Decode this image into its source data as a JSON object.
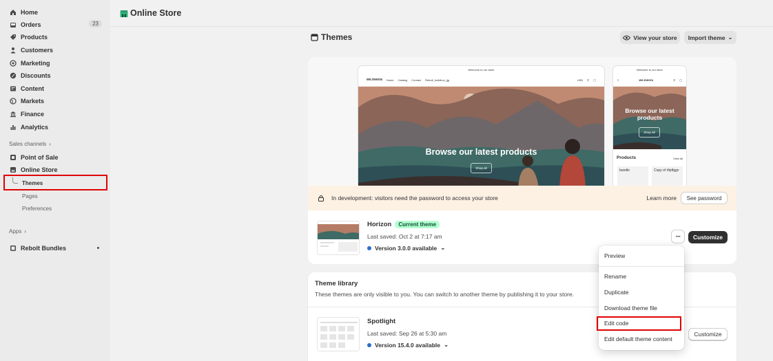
{
  "sidebar": {
    "items": [
      {
        "label": "Home",
        "icon": "home-icon"
      },
      {
        "label": "Orders",
        "icon": "inbox-icon",
        "badge": "23"
      },
      {
        "label": "Products",
        "icon": "tag-icon"
      },
      {
        "label": "Customers",
        "icon": "person-icon"
      },
      {
        "label": "Marketing",
        "icon": "target-icon"
      },
      {
        "label": "Discounts",
        "icon": "discount-icon"
      },
      {
        "label": "Content",
        "icon": "content-icon"
      },
      {
        "label": "Markets",
        "icon": "globe-icon"
      },
      {
        "label": "Finance",
        "icon": "bank-icon"
      },
      {
        "label": "Analytics",
        "icon": "chart-icon"
      }
    ],
    "sales_channels_label": "Sales channels",
    "channels": [
      {
        "label": "Point of Sale",
        "icon": "pos-icon"
      },
      {
        "label": "Online Store",
        "icon": "store-icon"
      }
    ],
    "store_sub": [
      "Themes",
      "Pages",
      "Preferences"
    ],
    "apps_label": "Apps",
    "apps": [
      {
        "label": "Rebolt Bundles",
        "icon": "app-icon"
      }
    ]
  },
  "header": {
    "title": "Online Store"
  },
  "main": {
    "title": "Themes",
    "view_store": "View your store",
    "import_theme": "Import theme"
  },
  "preview": {
    "desktop": {
      "announcement": "Welcome to our store",
      "brand": "we.meera",
      "nav": [
        "Home",
        "Catalog",
        "Contact",
        "Rebolt_buildbox_jjg"
      ],
      "currency": "USD",
      "hero_text": "Browse our latest products",
      "hero_button": "Shop all"
    },
    "mobile": {
      "announcement": "Welcome to our store",
      "brand": "we.meera",
      "hero_text": "Browse our latest products",
      "hero_button": "Shop all",
      "products_label": "Products",
      "view_all": "View all",
      "product1": "bundle",
      "product2": "Copy of rfiptfggv"
    }
  },
  "notice": {
    "text": "In development: visitors need the password to access your store",
    "learn_more": "Learn more",
    "see_password": "See password"
  },
  "current_theme": {
    "name": "Horizon",
    "badge": "Current theme",
    "saved": "Last saved: Oct 2 at 7:17 am",
    "version": "Version 3.0.0 available",
    "customize": "Customize"
  },
  "library": {
    "title": "Theme library",
    "desc": "These themes are only visible to you. You can switch to another theme by publishing it to your store.",
    "theme": {
      "name": "Spotlight",
      "saved": "Last saved: Sep 26 at 5:30 am",
      "version": "Version 15.4.0 available",
      "customize": "Customize"
    }
  },
  "menu": {
    "items": [
      "Preview",
      "Rename",
      "Duplicate",
      "Download theme file",
      "Edit code",
      "Edit default theme content"
    ]
  },
  "colors": {
    "highlight": "#e00000",
    "accent": "#303030",
    "badge_green": "#b4fed2"
  }
}
